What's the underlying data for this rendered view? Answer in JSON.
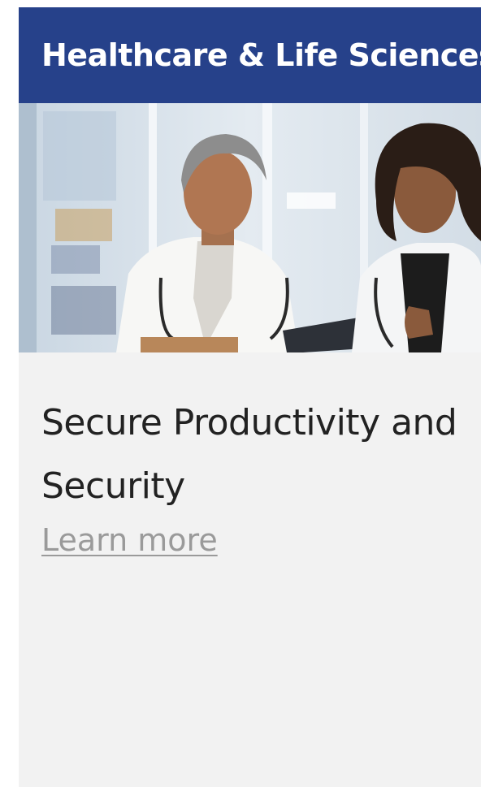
{
  "card": {
    "header_title": "Healthcare & Life Sciences",
    "image_icon": "photo-two-doctors-reviewing-tablet",
    "title": "Secure Productivity and Security",
    "link_label": "Learn more"
  },
  "colors": {
    "header_bg": "#26418a",
    "header_text": "#ffffff",
    "card_bg": "#f2f2f2",
    "title_text": "#222222",
    "link_text": "#9a9a9a"
  }
}
